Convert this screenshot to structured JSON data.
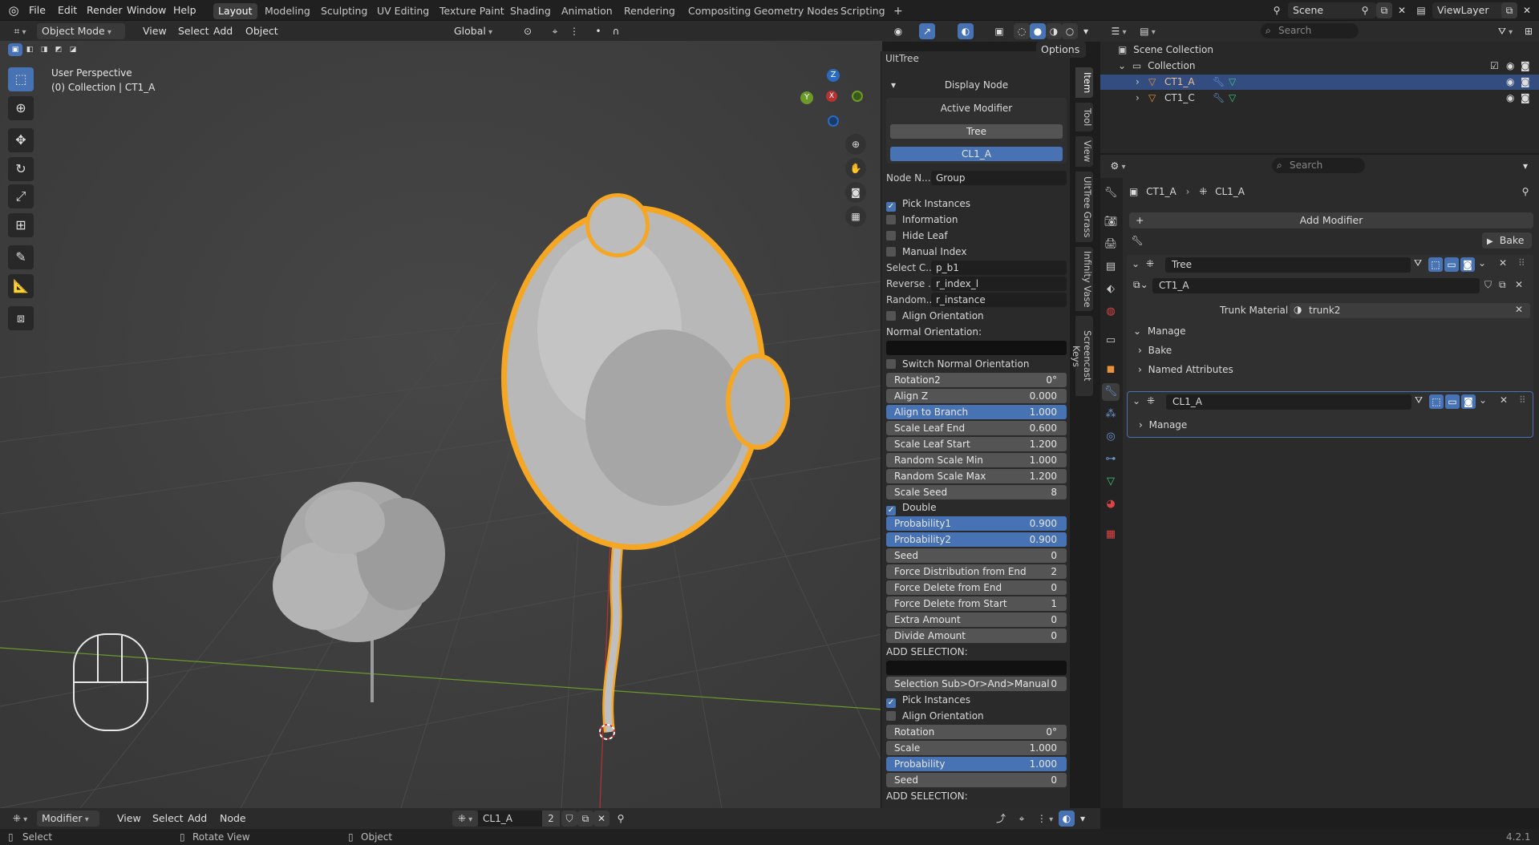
{
  "menu": [
    "File",
    "Edit",
    "Render",
    "Window",
    "Help"
  ],
  "workspaces": [
    "Layout",
    "Modeling",
    "Sculpting",
    "UV Editing",
    "Texture Paint",
    "Shading",
    "Animation",
    "Rendering",
    "Compositing",
    "Geometry Nodes",
    "Scripting"
  ],
  "active_workspace": "Layout",
  "scene": "Scene",
  "view_layer": "ViewLayer",
  "viewport": {
    "mode": "Object Mode",
    "menus": [
      "View",
      "Select",
      "Add",
      "Object"
    ],
    "orientation": "Global",
    "options": "Options",
    "overlay_title": "User Perspective",
    "overlay_sub": "(0) Collection | CT1_A",
    "gizmo_z": "Z",
    "gizmo_y": "Y",
    "gizmo_x": "X"
  },
  "npanel": {
    "section_cut": "UltTree",
    "display_node": "Display Node",
    "active_modifier": "Active Modifier",
    "mod_tree": "Tree",
    "mod_cl1": "CL1_A",
    "node_name_label": "Node N...",
    "node_name_value": "Group",
    "pick_instances": "Pick Instances",
    "information": "Information",
    "hide_leaf": "Hide Leaf",
    "manual_index": "Manual Index",
    "select_c_label": "Select C...",
    "select_c_value": "p_b1",
    "reverse_label": "Reverse ...",
    "reverse_value": "r_index_l",
    "random_label": "Random...",
    "random_value": "r_instance",
    "align_orientation": "Align Orientation",
    "normal_orientation": "Normal Orientation:",
    "switch_normal": "Switch Normal Orientation",
    "fields1": [
      {
        "label": "Rotation2",
        "value": "0°",
        "blue": false
      },
      {
        "label": "Align Z",
        "value": "0.000",
        "blue": false
      },
      {
        "label": "Align to Branch",
        "value": "1.000",
        "blue": true
      },
      {
        "label": "Scale Leaf End",
        "value": "0.600",
        "blue": false
      },
      {
        "label": "Scale Leaf Start",
        "value": "1.200",
        "blue": false
      },
      {
        "label": "Random Scale Min",
        "value": "1.000",
        "blue": false
      },
      {
        "label": "Random Scale Max",
        "value": "1.200",
        "blue": false
      },
      {
        "label": "Scale Seed",
        "value": "8",
        "blue": false
      }
    ],
    "double": "Double",
    "fields2": [
      {
        "label": "Probability1",
        "value": "0.900",
        "blue": true
      },
      {
        "label": "Probability2",
        "value": "0.900",
        "blue": true
      },
      {
        "label": "Seed",
        "value": "0",
        "blue": false
      },
      {
        "label": "Force Distribution from End",
        "value": "2",
        "blue": false
      },
      {
        "label": "Force Delete from End",
        "value": "0",
        "blue": false
      },
      {
        "label": "Force Delete from Start",
        "value": "1",
        "blue": false
      },
      {
        "label": "Extra Amount",
        "value": "0",
        "blue": false
      },
      {
        "label": "Divide Amount",
        "value": "0",
        "blue": false
      }
    ],
    "add_selection": "ADD SELECTION:",
    "selection_sub_label": "Selection Sub>Or>And>Manual",
    "selection_sub_value": "0",
    "pick_instances2": "Pick Instances",
    "align_orientation2": "Align Orientation",
    "fields3": [
      {
        "label": "Rotation",
        "value": "0°",
        "blue": false
      },
      {
        "label": "Scale",
        "value": "1.000",
        "blue": false
      },
      {
        "label": "Probability",
        "value": "1.000",
        "blue": true
      },
      {
        "label": "Seed",
        "value": "0",
        "blue": false
      }
    ],
    "add_selection2": "ADD SELECTION:",
    "tabs": [
      "Item",
      "Tool",
      "View",
      "UltTree Grass",
      "Infinity Vase",
      "Screencast Keys"
    ]
  },
  "outliner": {
    "search": "Search",
    "scene_collection": "Scene Collection",
    "collection": "Collection",
    "items": [
      "CT1_A",
      "CT1_C"
    ]
  },
  "properties": {
    "search": "Search",
    "breadcrumb_obj": "CT1_A",
    "breadcrumb_mod": "CL1_A",
    "add_modifier": "Add Modifier",
    "bake": "Bake",
    "mod1_name": "Tree",
    "mod1_group": "CT1_A",
    "trunk_material_label": "Trunk Material",
    "trunk_material": "trunk2",
    "manage": "Manage",
    "bake_panel": "Bake",
    "named_attributes": "Named Attributes",
    "mod2_name": "CL1_A",
    "manage2": "Manage"
  },
  "bottom": {
    "editor": "Modifier",
    "menus": [
      "View",
      "Select",
      "Add",
      "Node"
    ],
    "node_group": "CL1_A",
    "users": "2"
  },
  "status": {
    "select": "Select",
    "rotate": "Rotate View",
    "object": "Object",
    "version": "4.2.1"
  },
  "colors": {
    "accent": "#4772b3",
    "selection": "#f5a623",
    "background": "#3d3d3d"
  }
}
